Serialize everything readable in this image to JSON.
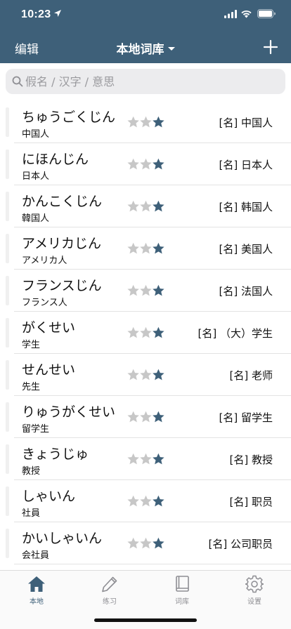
{
  "status": {
    "time": "10:23"
  },
  "nav": {
    "edit_label": "编辑",
    "title": "本地词库"
  },
  "search": {
    "placeholder": "假名 / 汉字 / 意思"
  },
  "colors": {
    "header": "#3e6079",
    "star_filled": "#3e6079",
    "star_empty": "#c7c7c7"
  },
  "words": [
    {
      "kana": "ちゅうごくじん",
      "kanji": "中国人",
      "meaning": "[名] 中国人",
      "stars": 1
    },
    {
      "kana": "にほんじん",
      "kanji": "日本人",
      "meaning": "[名] 日本人",
      "stars": 1
    },
    {
      "kana": "かんこくじん",
      "kanji": "韓国人",
      "meaning": "[名] 韩国人",
      "stars": 1
    },
    {
      "kana": "アメリカじん",
      "kanji": "アメリカ人",
      "meaning": "[名] 美国人",
      "stars": 1
    },
    {
      "kana": "フランスじん",
      "kanji": "フランス人",
      "meaning": "[名] 法国人",
      "stars": 1
    },
    {
      "kana": "がくせい",
      "kanji": "学生",
      "meaning": "[名] （大）学生",
      "stars": 1
    },
    {
      "kana": "せんせい",
      "kanji": "先生",
      "meaning": "[名] 老师",
      "stars": 1
    },
    {
      "kana": "りゅうがくせい",
      "kanji": "留学生",
      "meaning": "[名] 留学生",
      "stars": 1
    },
    {
      "kana": "きょうじゅ",
      "kanji": "教授",
      "meaning": "[名] 教授",
      "stars": 1
    },
    {
      "kana": "しゃいん",
      "kanji": "社員",
      "meaning": "[名] 职员",
      "stars": 1
    },
    {
      "kana": "かいしゃいん",
      "kanji": "会社員",
      "meaning": "[名] 公司职员",
      "stars": 1
    }
  ],
  "tabs": [
    {
      "label": "本地",
      "icon": "home-icon",
      "active": true
    },
    {
      "label": "练习",
      "icon": "pencil-icon",
      "active": false
    },
    {
      "label": "词库",
      "icon": "book-icon",
      "active": false
    },
    {
      "label": "设置",
      "icon": "gear-icon",
      "active": false
    }
  ]
}
